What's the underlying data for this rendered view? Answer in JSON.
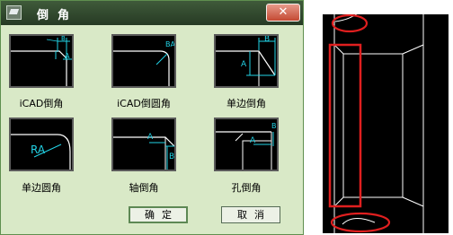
{
  "dialog": {
    "title": "倒角",
    "close_label": "✕",
    "options": [
      {
        "label": "iCAD倒角"
      },
      {
        "label": "iCAD倒圆角"
      },
      {
        "label": "单边倒角"
      },
      {
        "label": "单边圆角"
      },
      {
        "label": "轴倒角"
      },
      {
        "label": "孔倒角"
      }
    ],
    "ok_label": "确定",
    "cancel_label": "取消"
  },
  "dims": {
    "a": "A",
    "b": "B",
    "ba": "BA",
    "ra": "RA"
  },
  "colors": {
    "cad_line": "#ffffff",
    "dimension": "#22d3e6",
    "highlight": "#e01f1f",
    "dialog_bg": "#d9e9c7",
    "titlebar": "#2f462c"
  }
}
